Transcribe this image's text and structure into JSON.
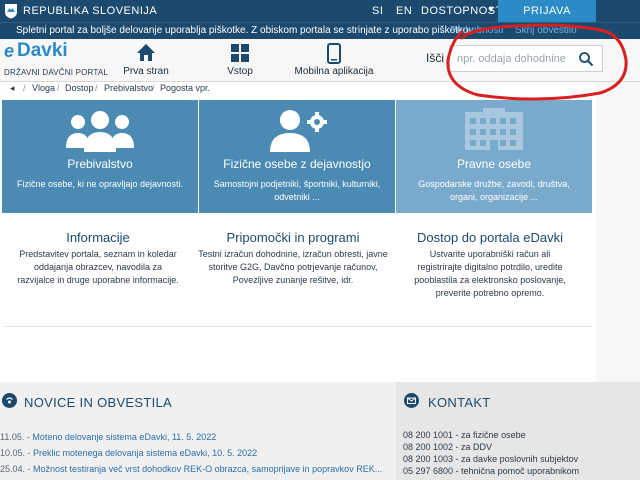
{
  "gov_bar": {
    "title": "REPUBLIKA SLOVENIJA",
    "lang_si": "SI",
    "lang_en": "EN",
    "accessibility": "DOSTOPNOST",
    "login": "PRIJAVA"
  },
  "cookie_bar": {
    "text": "Spletni portal za boljše delovanje uporablja piškotke. Z obiskom portala se strinjate z uporabo piškotkov.",
    "more": "Podrobnosti",
    "hide": "Skrij obvestilo"
  },
  "header": {
    "logo_e": "e",
    "logo_text": "Davki",
    "logo_sub": "DRŽAVNI DAVČNI PORTAL",
    "nav": [
      {
        "label": "Prva stran",
        "icon": "home-icon"
      },
      {
        "label": "Vstop",
        "icon": "grid-icon"
      },
      {
        "label": "Mobilna aplikacija",
        "icon": "mobile-icon"
      }
    ],
    "search_label": "Išči",
    "search_placeholder": "npr. oddaja dohodnine"
  },
  "breadcrumb": [
    "Vloga",
    "Dostop",
    "Prebivalstvo",
    "Pogosta vpr."
  ],
  "tiles": [
    {
      "title": "Prebivalstvo",
      "sub": "Fizične osebe, ki ne opravljajo dejavnosti.",
      "icon": "people-icon"
    },
    {
      "title": "Fizične osebe z dejavnostjo",
      "sub": "Samostojni podjetniki, športniki, kulturniki, odvetniki ...",
      "icon": "person-gear-icon"
    },
    {
      "title": "Pravne osebe",
      "sub": "Gospodarske družbe, zavodi, društva, organi, organizacije ...",
      "icon": "building-icon"
    }
  ],
  "info": [
    {
      "title": "Informacije",
      "text": "Predstavitev portala, seznam in koledar oddajanja obrazcev, navodila za razvijalce in druge uporabne informacije."
    },
    {
      "title": "Pripomočki in programi",
      "text": "Testni izračun dohodnine, izračun obresti, javne storitve G2G, Davčno potrjevanje računov, Povezljive zunanje rešitve, idr."
    },
    {
      "title": "Dostop do portala eDavki",
      "text": "Ustvarite uporabniški račun ali registrirajte digitalno potrdilo, uredite pooblastila za elektronsko poslovanje, preverite potrebno opremo."
    }
  ],
  "news": {
    "title": "NOVICE IN OBVESTILA",
    "items": [
      {
        "date": "11.05.",
        "text": "Moteno delovanje sistema eDavki, 11. 5. 2022"
      },
      {
        "date": "10.05.",
        "text": "Preklic motenega delovanja sistema eDavki, 10. 5. 2022"
      },
      {
        "date": "25.04.",
        "text": "Možnost testiranja več vrst dohodkov REK-O obrazca, samoprijave in popravkov REK..."
      }
    ]
  },
  "contact": {
    "title": "KONTAKT",
    "lines": [
      "08 200 1001 - za fizične osebe",
      "08 200 1002 - za DDV",
      "08 200 1003 - za davke poslovnih subjektov",
      "05 297 6800 - tehnična pomoč uporabnikom"
    ]
  },
  "colors": {
    "navy": "#1c4a6e",
    "accent": "#2b8bc6",
    "tile": "#4a8ab3",
    "tile_light": "#7aaacb",
    "annotation": "#d92020"
  }
}
